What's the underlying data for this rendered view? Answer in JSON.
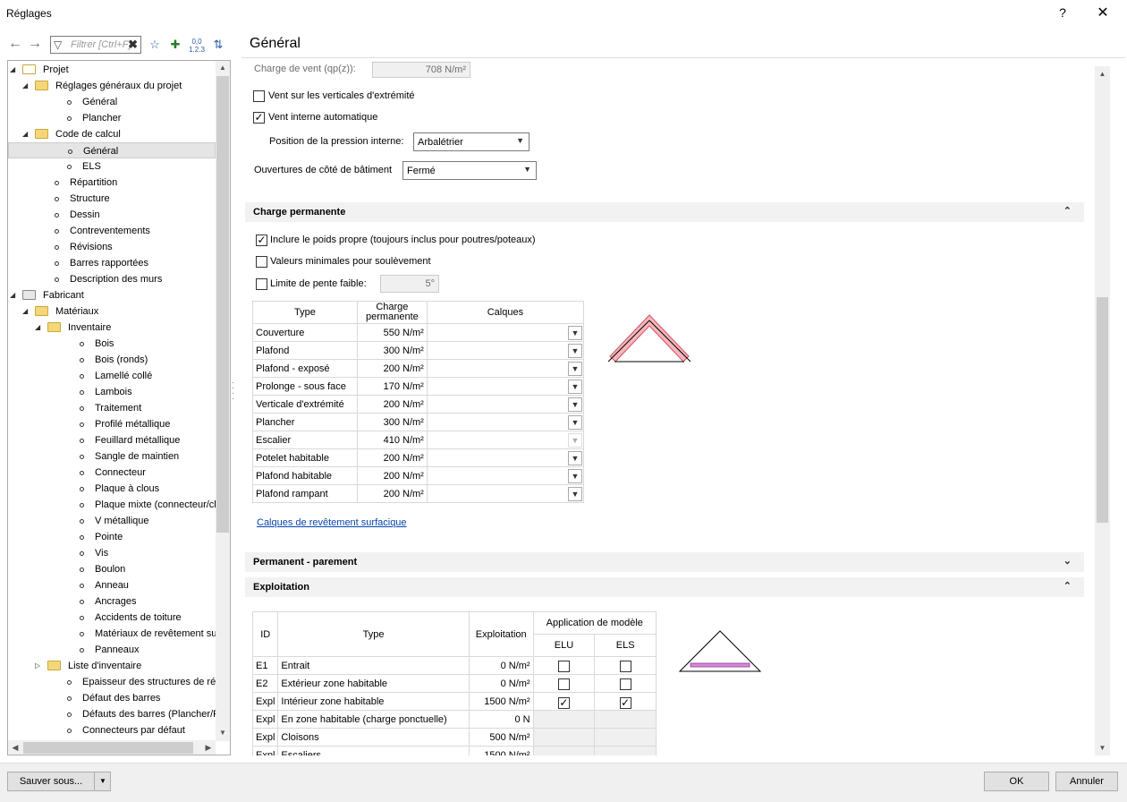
{
  "window": {
    "title": "Réglages",
    "help": "?",
    "close": "✕"
  },
  "nav": {
    "back": "←",
    "forward": "→",
    "filter_placeholder": "Filtrer [Ctrl+F]",
    "filter_clear": "✖"
  },
  "tree": {
    "items": [
      {
        "label": "Projet",
        "level": 0,
        "type": "home",
        "expander": "◢"
      },
      {
        "label": "Réglages généraux du projet",
        "level": 1,
        "type": "folder",
        "expander": "◢"
      },
      {
        "label": "Général",
        "level": 2,
        "type": "bullet"
      },
      {
        "label": "Plancher",
        "level": 2,
        "type": "bullet"
      },
      {
        "label": "Code de calcul",
        "level": 1,
        "type": "folder",
        "expander": "◢"
      },
      {
        "label": "Général",
        "level": 2,
        "type": "bullet",
        "selected": true
      },
      {
        "label": "ELS",
        "level": 2,
        "type": "bullet"
      },
      {
        "label": "Répartition",
        "level": 1,
        "type": "bullet"
      },
      {
        "label": "Structure",
        "level": 1,
        "type": "bullet"
      },
      {
        "label": "Dessin",
        "level": 1,
        "type": "bullet"
      },
      {
        "label": "Contreventements",
        "level": 1,
        "type": "bullet"
      },
      {
        "label": "Révisions",
        "level": 1,
        "type": "bullet"
      },
      {
        "label": "Barres rapportées",
        "level": 1,
        "type": "bullet"
      },
      {
        "label": "Description des murs",
        "level": 1,
        "type": "bullet"
      },
      {
        "label": "Fabricant",
        "level": 0,
        "type": "fab",
        "expander": "◢"
      },
      {
        "label": "Matériaux",
        "level": 1,
        "type": "folder",
        "expander": "◢"
      },
      {
        "label": "Inventaire",
        "level": 2,
        "type": "folder",
        "expander": "◢"
      },
      {
        "label": "Bois",
        "level": 3,
        "type": "bullet"
      },
      {
        "label": "Bois (ronds)",
        "level": 3,
        "type": "bullet"
      },
      {
        "label": "Lamellé collé",
        "level": 3,
        "type": "bullet"
      },
      {
        "label": "Lambois",
        "level": 3,
        "type": "bullet"
      },
      {
        "label": "Traitement",
        "level": 3,
        "type": "bullet"
      },
      {
        "label": "Profilé métallique",
        "level": 3,
        "type": "bullet"
      },
      {
        "label": "Feuillard métallique",
        "level": 3,
        "type": "bullet"
      },
      {
        "label": "Sangle de maintien",
        "level": 3,
        "type": "bullet"
      },
      {
        "label": "Connecteur",
        "level": 3,
        "type": "bullet"
      },
      {
        "label": "Plaque à clous",
        "level": 3,
        "type": "bullet"
      },
      {
        "label": "Plaque mixte (connecteur/clous",
        "level": 3,
        "type": "bullet"
      },
      {
        "label": "V métallique",
        "level": 3,
        "type": "bullet"
      },
      {
        "label": "Pointe",
        "level": 3,
        "type": "bullet"
      },
      {
        "label": "Vis",
        "level": 3,
        "type": "bullet"
      },
      {
        "label": "Boulon",
        "level": 3,
        "type": "bullet"
      },
      {
        "label": "Anneau",
        "level": 3,
        "type": "bullet"
      },
      {
        "label": "Ancrages",
        "level": 3,
        "type": "bullet"
      },
      {
        "label": "Accidents de toiture",
        "level": 3,
        "type": "bullet"
      },
      {
        "label": "Matériaux de revêtement surfaci",
        "level": 3,
        "type": "bullet"
      },
      {
        "label": "Panneaux",
        "level": 3,
        "type": "bullet"
      },
      {
        "label": "Liste d'inventaire",
        "level": 2,
        "type": "folder",
        "expander": "▷"
      },
      {
        "label": "Epaisseur des structures de répartit",
        "level": 2,
        "type": "bullet"
      },
      {
        "label": "Défaut des barres",
        "level": 2,
        "type": "bullet"
      },
      {
        "label": "Défauts des barres (Plancher/Posi)",
        "level": 2,
        "type": "bullet"
      },
      {
        "label": "Connecteurs par défaut",
        "level": 2,
        "type": "bullet"
      }
    ]
  },
  "main": {
    "title": "Général",
    "wind": {
      "charge_label": "Charge de vent (qp(z)):",
      "charge_value": "708 N/m²",
      "vert_ext_label": "Vent sur les verticales d'extrémité",
      "vert_ext_checked": false,
      "interne_label": "Vent interne automatique",
      "interne_checked": true,
      "position_label": "Position de la pression interne:",
      "position_value": "Arbalétrier",
      "ouvertures_label": "Ouvertures de côté de bâtiment",
      "ouvertures_value": "Fermé"
    },
    "permanent": {
      "header": "Charge permanente",
      "chevron": "⌃",
      "poids_label": "Inclure le poids propre (toujours inclus pour poutres/poteaux)",
      "poids_checked": true,
      "soulev_label": "Valeurs minimales pour soulèvement",
      "soulev_checked": false,
      "pente_label": "Limite de pente faible:",
      "pente_checked": false,
      "pente_value": "5°",
      "col_type": "Type",
      "col_charge": "Charge\npermanente",
      "col_calques": "Calques",
      "rows": [
        {
          "type": "Couverture",
          "charge": "550 N/m²"
        },
        {
          "type": "Plafond",
          "charge": "300 N/m²"
        },
        {
          "type": "Plafond - exposé",
          "charge": "200 N/m²"
        },
        {
          "type": "Prolonge - sous face",
          "charge": "170 N/m²"
        },
        {
          "type": "Verticale d'extrémité",
          "charge": "200 N/m²"
        },
        {
          "type": "Plancher",
          "charge": "300 N/m²"
        },
        {
          "type": "Escalier",
          "charge": "410 N/m²",
          "disabled": true
        },
        {
          "type": "Potelet habitable",
          "charge": "200 N/m²"
        },
        {
          "type": "Plafond habitable",
          "charge": "200 N/m²"
        },
        {
          "type": "Plafond rampant",
          "charge": "200 N/m²"
        }
      ],
      "link": "Calques de revêtement surfacique"
    },
    "parement": {
      "header": "Permanent - parement",
      "chevron": "⌄"
    },
    "exploitation": {
      "header": "Exploitation",
      "chevron": "⌃",
      "col_id": "ID",
      "col_type": "Type",
      "col_expl": "Exploitation",
      "col_app": "Application de modèle",
      "col_elu": "ELU",
      "col_els": "ELS",
      "rows": [
        {
          "id": "E1",
          "type": "Entrait",
          "value": "0 N/m²",
          "elu": false,
          "els": false,
          "boxes": true
        },
        {
          "id": "E2",
          "type": "Extérieur zone habitable",
          "value": "0 N/m²",
          "elu": false,
          "els": false,
          "boxes": true
        },
        {
          "id": "Expl",
          "type": "Intérieur zone habitable",
          "value": "1500 N/m²",
          "elu": true,
          "els": true,
          "boxes": true
        },
        {
          "id": "Expl",
          "type": "En zone habitable (charge ponctuelle)",
          "value": "0 N",
          "boxes": false
        },
        {
          "id": "Expl",
          "type": "Cloisons",
          "value": "500 N/m²",
          "boxes": false
        },
        {
          "id": "Expl",
          "type": "Escaliers",
          "value": "1500 N/m²",
          "boxes": false
        }
      ]
    }
  },
  "footer": {
    "save_as": "Sauver sous...",
    "ok": "OK",
    "cancel": "Annuler"
  },
  "colors": {
    "roof_fill": "#f4b6bd",
    "roof_stroke": "#d4505e",
    "floor_fill": "#d58ad6",
    "link": "#0645ad"
  }
}
